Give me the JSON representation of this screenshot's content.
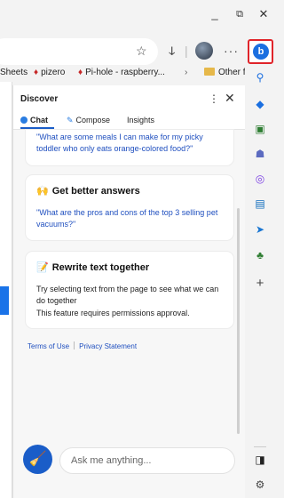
{
  "window": {
    "minimize": "_",
    "restore": "⧉",
    "close": "✕"
  },
  "toolbar": {
    "favorite_icon": "star-add-icon",
    "refresh_icon": "☁",
    "more_label": "···"
  },
  "favorites": [
    {
      "label": "Sheets",
      "icon": "sheets-icon"
    },
    {
      "label": "pizero",
      "icon": "raspberry-icon"
    },
    {
      "label": "Pi-hole - raspberry...",
      "icon": "raspberry-icon"
    },
    {
      "label": "Other f",
      "icon": "folder-icon"
    }
  ],
  "favorites_more": "›",
  "panel": {
    "title": "Discover",
    "more": "⋮",
    "close": "✕",
    "tabs": [
      {
        "label": "Chat",
        "active": true
      },
      {
        "label": "Compose",
        "active": false
      },
      {
        "label": "Insights",
        "active": false
      }
    ]
  },
  "cards": [
    {
      "link": "\"What are some meals I can make for my picky toddler who only eats orange-colored food?\""
    },
    {
      "emoji": "🙌",
      "title": "Get better answers",
      "link": "\"What are the pros and cons of the top 3 selling pet vacuums?\""
    },
    {
      "emoji": "📝",
      "title": "Rewrite text together",
      "text": "Try selecting text from the page to see what we can do together",
      "note": "This feature requires permissions approval."
    }
  ],
  "legal": {
    "terms": "Terms of Use",
    "privacy": "Privacy Statement"
  },
  "chat_input": {
    "placeholder": "Ask me anything..."
  },
  "rail": {
    "bing_label": "b",
    "add_label": "+"
  },
  "colors": {
    "accent": "#1a5dc8",
    "link": "#1f4fbf",
    "highlight_border": "#e0242a"
  }
}
